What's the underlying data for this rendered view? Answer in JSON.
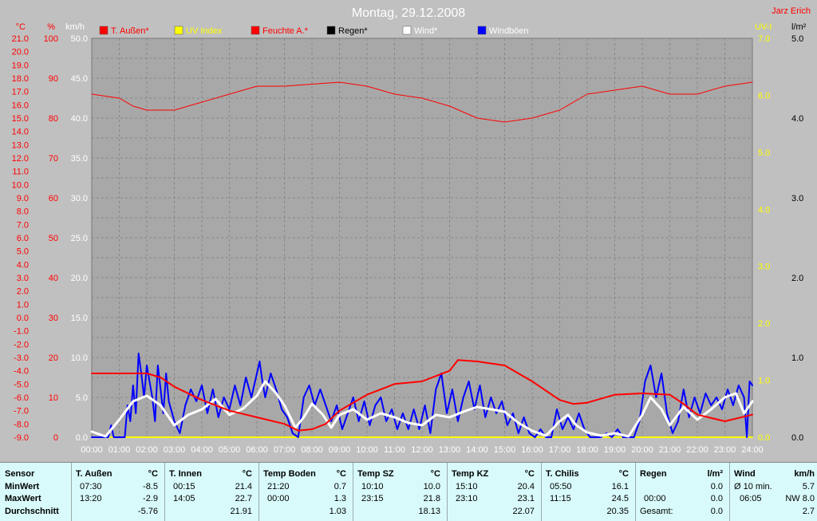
{
  "chart_data": {
    "type": "line",
    "title": "Montag, 29.12.2008",
    "author": "Jarz Erich",
    "left_axes": [
      {
        "unit": "°C",
        "color": "#ff0000",
        "min": -9.0,
        "max": 21.0,
        "step": 1.0,
        "decimals": 1
      },
      {
        "unit": "%",
        "color": "#ff0000",
        "min": 0,
        "max": 100,
        "step": 10,
        "decimals": 0
      },
      {
        "unit": "km/h",
        "color": "#ffffff",
        "min": 0.0,
        "max": 50.0,
        "step": 5.0,
        "decimals": 1
      }
    ],
    "right_axes": [
      {
        "unit": "UV-I",
        "color": "#ffff00",
        "min": 0.0,
        "max": 7.0,
        "step": 1.0,
        "decimals": 1
      },
      {
        "unit": "l/m²",
        "color": "#000000",
        "min": 0.0,
        "max": 5.0,
        "step": 1.0,
        "decimals": 1
      }
    ],
    "x_ticks": [
      "00:00",
      "01:00",
      "02:00",
      "03:00",
      "04:00",
      "05:00",
      "06:00",
      "07:00",
      "08:00",
      "09:00",
      "10:00",
      "11:00",
      "12:00",
      "13:00",
      "14:00",
      "15:00",
      "16:00",
      "17:00",
      "18:00",
      "19:00",
      "20:00",
      "21:00",
      "22:00",
      "23:00",
      "24:00"
    ],
    "grid": true,
    "legend_position": "top",
    "series": [
      {
        "name": "T. Außen*",
        "color": "#ff0000",
        "axis": "°C",
        "width": 2,
        "points": [
          [
            0,
            -4.2
          ],
          [
            1,
            -4.2
          ],
          [
            1.5,
            -4.2
          ],
          [
            2,
            -4.2
          ],
          [
            2.5,
            -4.5
          ],
          [
            3,
            -5.2
          ],
          [
            4,
            -6.2
          ],
          [
            5,
            -7.0
          ],
          [
            6,
            -7.5
          ],
          [
            7,
            -8.0
          ],
          [
            7.5,
            -8.5
          ],
          [
            8,
            -8.4
          ],
          [
            8.5,
            -8.0
          ],
          [
            9,
            -7.0
          ],
          [
            10,
            -5.8
          ],
          [
            11,
            -5.0
          ],
          [
            12,
            -4.8
          ],
          [
            13,
            -4.0
          ],
          [
            13.3,
            -3.2
          ],
          [
            14,
            -3.3
          ],
          [
            15,
            -3.6
          ],
          [
            16,
            -4.8
          ],
          [
            17,
            -6.2
          ],
          [
            17.5,
            -6.5
          ],
          [
            18,
            -6.4
          ],
          [
            19,
            -5.8
          ],
          [
            20,
            -5.7
          ],
          [
            21,
            -5.8
          ],
          [
            21.5,
            -6.5
          ],
          [
            22,
            -7.3
          ],
          [
            23,
            -7.8
          ],
          [
            24,
            -7.3
          ]
        ]
      },
      {
        "name": "Feuchte A.*",
        "color": "#ff0000",
        "axis": "%",
        "width": 1,
        "points": [
          [
            0,
            86
          ],
          [
            1,
            85
          ],
          [
            1.5,
            83
          ],
          [
            2,
            82
          ],
          [
            3,
            82
          ],
          [
            4,
            84
          ],
          [
            5,
            86
          ],
          [
            6,
            88
          ],
          [
            7,
            88
          ],
          [
            8,
            88.5
          ],
          [
            9,
            89
          ],
          [
            10,
            88
          ],
          [
            11,
            86
          ],
          [
            12,
            85
          ],
          [
            13,
            83
          ],
          [
            14,
            80
          ],
          [
            15,
            79
          ],
          [
            16,
            80
          ],
          [
            17,
            82
          ],
          [
            18,
            86
          ],
          [
            19,
            87
          ],
          [
            20,
            88
          ],
          [
            21,
            86
          ],
          [
            22,
            86
          ],
          [
            23,
            88
          ],
          [
            24,
            89
          ]
        ]
      },
      {
        "name": "Wind*",
        "color": "#ffffff",
        "axis": "km/h",
        "width": 3,
        "points": [
          [
            0,
            0.7
          ],
          [
            0.5,
            0.1
          ],
          [
            1,
            2.2
          ],
          [
            1.5,
            4.5
          ],
          [
            2,
            5.2
          ],
          [
            2.5,
            4.0
          ],
          [
            3,
            1.5
          ],
          [
            3.5,
            2.8
          ],
          [
            4,
            3.5
          ],
          [
            4.5,
            4.8
          ],
          [
            5,
            2.8
          ],
          [
            5.5,
            3.6
          ],
          [
            6,
            5.2
          ],
          [
            6.3,
            7.0
          ],
          [
            6.7,
            5.5
          ],
          [
            7,
            4.0
          ],
          [
            7.4,
            1.2
          ],
          [
            7.7,
            2.5
          ],
          [
            8,
            4.2
          ],
          [
            8.4,
            2.8
          ],
          [
            8.7,
            1.2
          ],
          [
            9,
            2.8
          ],
          [
            9.5,
            3.5
          ],
          [
            10,
            2.2
          ],
          [
            10.5,
            3.0
          ],
          [
            11,
            2.5
          ],
          [
            11.5,
            1.8
          ],
          [
            12,
            1.5
          ],
          [
            12.5,
            2.8
          ],
          [
            13,
            2.5
          ],
          [
            13.5,
            3.2
          ],
          [
            14,
            3.8
          ],
          [
            14.5,
            3.5
          ],
          [
            15,
            3.2
          ],
          [
            15.5,
            1.8
          ],
          [
            16,
            0.8
          ],
          [
            16.5,
            0.2
          ],
          [
            17,
            2.0
          ],
          [
            17.3,
            2.8
          ],
          [
            17.6,
            1.5
          ],
          [
            18,
            0.6
          ],
          [
            18.5,
            0.2
          ],
          [
            19,
            0.5
          ],
          [
            19.5,
            0.1
          ],
          [
            20,
            2.8
          ],
          [
            20.3,
            5.0
          ],
          [
            20.7,
            3.5
          ],
          [
            21,
            1.5
          ],
          [
            21.5,
            3.8
          ],
          [
            22,
            2.2
          ],
          [
            22.5,
            3.5
          ],
          [
            23,
            5.0
          ],
          [
            23.4,
            5.5
          ],
          [
            23.7,
            3.0
          ],
          [
            24,
            4.5
          ]
        ]
      },
      {
        "name": "Windböen",
        "color": "#0000ff",
        "axis": "km/h",
        "width": 2,
        "points": [
          [
            0,
            0
          ],
          [
            0.6,
            0
          ],
          [
            0.7,
            1.5
          ],
          [
            0.8,
            0
          ],
          [
            1.2,
            0
          ],
          [
            1.3,
            4.0
          ],
          [
            1.4,
            2.0
          ],
          [
            1.5,
            6.5
          ],
          [
            1.6,
            3.0
          ],
          [
            1.7,
            10.5
          ],
          [
            1.8,
            8.0
          ],
          [
            1.9,
            5.0
          ],
          [
            2.0,
            9.0
          ],
          [
            2.1,
            7.0
          ],
          [
            2.2,
            5.0
          ],
          [
            2.3,
            2.0
          ],
          [
            2.4,
            9.0
          ],
          [
            2.5,
            6.0
          ],
          [
            2.6,
            3.0
          ],
          [
            2.7,
            8.0
          ],
          [
            2.8,
            4.5
          ],
          [
            3.0,
            2.0
          ],
          [
            3.2,
            0.5
          ],
          [
            3.4,
            4.0
          ],
          [
            3.6,
            6.0
          ],
          [
            3.8,
            4.5
          ],
          [
            4.0,
            6.5
          ],
          [
            4.2,
            3.0
          ],
          [
            4.4,
            6.0
          ],
          [
            4.6,
            2.5
          ],
          [
            4.8,
            5.0
          ],
          [
            5.0,
            3.5
          ],
          [
            5.2,
            6.5
          ],
          [
            5.4,
            4.0
          ],
          [
            5.6,
            7.5
          ],
          [
            5.8,
            5.0
          ],
          [
            6.0,
            8.0
          ],
          [
            6.1,
            9.5
          ],
          [
            6.2,
            7.0
          ],
          [
            6.3,
            5.0
          ],
          [
            6.5,
            8.0
          ],
          [
            6.7,
            6.0
          ],
          [
            6.9,
            3.5
          ],
          [
            7.1,
            2.5
          ],
          [
            7.3,
            0.5
          ],
          [
            7.5,
            0.0
          ],
          [
            7.7,
            5.0
          ],
          [
            7.9,
            6.5
          ],
          [
            8.1,
            4.0
          ],
          [
            8.3,
            6.0
          ],
          [
            8.5,
            4.0
          ],
          [
            8.7,
            2.0
          ],
          [
            8.9,
            4.0
          ],
          [
            9.1,
            1.0
          ],
          [
            9.3,
            3.0
          ],
          [
            9.5,
            5.0
          ],
          [
            9.7,
            2.0
          ],
          [
            9.9,
            4.5
          ],
          [
            10.1,
            1.5
          ],
          [
            10.3,
            4.0
          ],
          [
            10.5,
            5.0
          ],
          [
            10.7,
            2.0
          ],
          [
            10.9,
            3.5
          ],
          [
            11.1,
            1.0
          ],
          [
            11.3,
            3.0
          ],
          [
            11.5,
            1.0
          ],
          [
            11.7,
            3.5
          ],
          [
            11.9,
            1.0
          ],
          [
            12.1,
            4.0
          ],
          [
            12.3,
            0.5
          ],
          [
            12.5,
            6.0
          ],
          [
            12.7,
            8.0
          ],
          [
            12.9,
            3.0
          ],
          [
            13.1,
            6.0
          ],
          [
            13.3,
            2.0
          ],
          [
            13.5,
            5.0
          ],
          [
            13.7,
            7.0
          ],
          [
            13.9,
            3.5
          ],
          [
            14.1,
            6.5
          ],
          [
            14.3,
            2.5
          ],
          [
            14.5,
            5.0
          ],
          [
            14.7,
            3.0
          ],
          [
            14.9,
            4.5
          ],
          [
            15.1,
            1.5
          ],
          [
            15.3,
            3.0
          ],
          [
            15.5,
            0.5
          ],
          [
            15.7,
            2.5
          ],
          [
            15.9,
            0.5
          ],
          [
            16.1,
            0.0
          ],
          [
            16.3,
            1.0
          ],
          [
            16.5,
            0.0
          ],
          [
            16.7,
            0.0
          ],
          [
            16.9,
            3.5
          ],
          [
            17.1,
            1.0
          ],
          [
            17.3,
            2.5
          ],
          [
            17.5,
            1.0
          ],
          [
            17.7,
            3.0
          ],
          [
            17.9,
            1.0
          ],
          [
            18.1,
            0.0
          ],
          [
            18.5,
            0.0
          ],
          [
            18.7,
            0.5
          ],
          [
            18.9,
            0.0
          ],
          [
            19.1,
            1.0
          ],
          [
            19.3,
            0.0
          ],
          [
            19.7,
            0.0
          ],
          [
            19.9,
            2.0
          ],
          [
            20.1,
            7.0
          ],
          [
            20.3,
            9.0
          ],
          [
            20.5,
            5.0
          ],
          [
            20.7,
            8.0
          ],
          [
            20.9,
            3.0
          ],
          [
            21.1,
            0.5
          ],
          [
            21.3,
            2.0
          ],
          [
            21.5,
            6.0
          ],
          [
            21.7,
            2.5
          ],
          [
            21.9,
            5.0
          ],
          [
            22.1,
            3.0
          ],
          [
            22.3,
            5.5
          ],
          [
            22.5,
            4.0
          ],
          [
            22.7,
            5.0
          ],
          [
            22.9,
            3.5
          ],
          [
            23.1,
            6.0
          ],
          [
            23.3,
            4.0
          ],
          [
            23.5,
            6.5
          ],
          [
            23.7,
            5.0
          ],
          [
            23.8,
            0.0
          ],
          [
            23.9,
            7.0
          ],
          [
            24.0,
            6.5
          ]
        ]
      },
      {
        "name": "UV Index",
        "color": "#ffff00",
        "axis": "UV-I",
        "width": 2,
        "points": [
          [
            0,
            0
          ],
          [
            24,
            0
          ]
        ]
      },
      {
        "name": "Regen*",
        "color": "#000000",
        "axis": "l/m²",
        "width": 1,
        "points": [
          [
            0,
            0
          ],
          [
            24,
            0
          ]
        ]
      }
    ]
  },
  "legend": [
    {
      "label": "T. Außen*",
      "color": "#ff0000",
      "text_color": "#ff0000"
    },
    {
      "label": "UV Index",
      "color": "#ffff00",
      "text_color": "#ffff00"
    },
    {
      "label": "Feuchte A.*",
      "color": "#ff0000",
      "text_color": "#ff0000"
    },
    {
      "label": "Regen*",
      "color": "#000000",
      "text_color": "#000000"
    },
    {
      "label": "Wind*",
      "color": "#ffffff",
      "text_color": "#ffffff"
    },
    {
      "label": "Windböen",
      "color": "#0000ff",
      "text_color": "#ffffff"
    }
  ],
  "stats": {
    "row_labels": [
      "Sensor",
      "MinWert",
      "MaxWert",
      "Durchschnitt"
    ],
    "columns": [
      {
        "name": "T. Außen",
        "unit": "°C",
        "min_time": "07:30",
        "min": "-8.5",
        "max_time": "13:20",
        "max": "-2.9",
        "avg": "-5.76"
      },
      {
        "name": "T. Innen",
        "unit": "°C",
        "min_time": "00:15",
        "min": "21.4",
        "max_time": "14:05",
        "max": "22.7",
        "avg": "21.91"
      },
      {
        "name": "Temp Boden",
        "unit": "°C",
        "min_time": "21:20",
        "min": "0.7",
        "max_time": "00:00",
        "max": "1.3",
        "avg": "1.03"
      },
      {
        "name": "Temp SZ",
        "unit": "°C",
        "min_time": "10:10",
        "min": "10.0",
        "max_time": "23:15",
        "max": "21.8",
        "avg": "18.13"
      },
      {
        "name": "Temp KZ",
        "unit": "°C",
        "min_time": "15:10",
        "min": "20.4",
        "max_time": "23:10",
        "max": "23.1",
        "avg": "22.07"
      },
      {
        "name": "T. Chilis",
        "unit": "°C",
        "min_time": "05:50",
        "min": "16.1",
        "max_time": "11:15",
        "max": "24.5",
        "avg": "20.35"
      }
    ],
    "rain": {
      "name": "Regen",
      "unit": "l/m²",
      "min_time": "",
      "min": "0.0",
      "max_time": "00:00",
      "max": "0.0",
      "avg_label": "Gesamt:",
      "avg": "0.0"
    },
    "wind": {
      "name": "Wind",
      "unit": "km/h",
      "min_label": "Ø 10 min.",
      "min": "5.7",
      "max_time": "06:05",
      "max": "NW 8.0",
      "avg": "2.7"
    }
  }
}
